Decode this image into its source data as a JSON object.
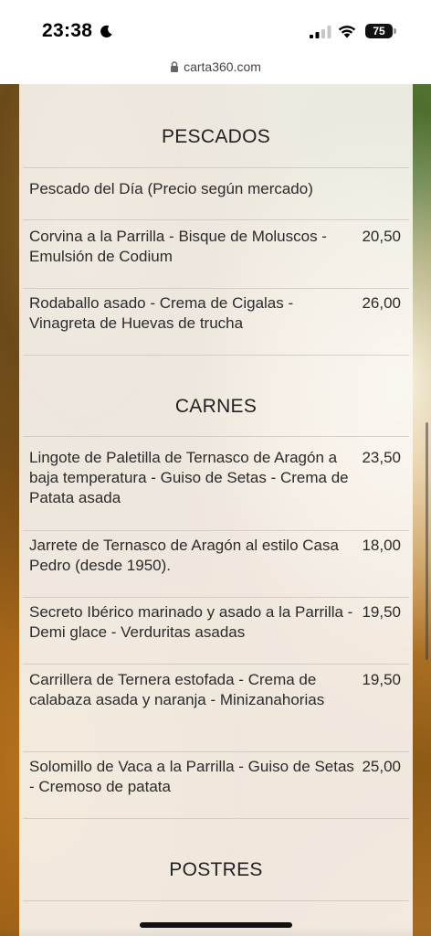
{
  "status_bar": {
    "time": "23:38",
    "battery": "75"
  },
  "browser": {
    "url": "carta360.com"
  },
  "menu": {
    "sections": [
      {
        "title": "PESCADOS",
        "items": [
          {
            "dish": "Pescado del Día (Precio según mercado)",
            "price": ""
          },
          {
            "dish": "Corvina a la Parrilla - Bisque de Moluscos - Emulsión de Codium",
            "price": "20,50"
          },
          {
            "dish": "Rodaballo asado - Crema de Cigalas - Vinagreta de Huevas de trucha",
            "price": "26,00"
          }
        ]
      },
      {
        "title": "CARNES",
        "items": [
          {
            "dish": "Lingote de Paletilla de Ternasco de Aragón a baja temperatura - Guiso de Setas - Crema de Patata asada",
            "price": "23,50"
          },
          {
            "dish": "Jarrete de Ternasco de Aragón al estilo Casa Pedro (desde 1950).",
            "price": "18,00"
          },
          {
            "dish": "Secreto Ibérico marinado y asado a la Parrilla - Demi glace - Verduritas asadas",
            "price": "19,50"
          },
          {
            "dish": "Carrillera de Ternera estofada - Crema de calabaza asada y naranja - Minizanahorias",
            "price": "19,50"
          },
          {
            "dish": "Solomillo de Vaca a la Parrilla - Guiso de Setas - Cremoso de patata",
            "price": "25,00"
          }
        ]
      },
      {
        "title": "POSTRES",
        "items": []
      }
    ]
  }
}
